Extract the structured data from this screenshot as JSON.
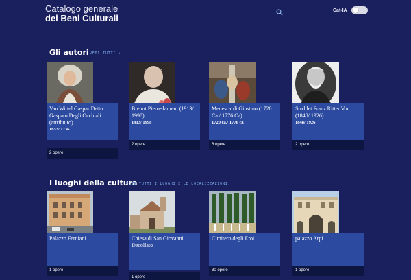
{
  "header": {
    "title_line1": "Catalogo generale",
    "title_line2": "dei Beni Culturali",
    "toggle_label": "Cat-IA"
  },
  "authors": {
    "title": "Gli autori",
    "see_all": "VEDI TUTTI ›",
    "items": [
      {
        "name": "Van Wittel Gaspar Detto Gasparo Degli Occhiali (attribuito)",
        "dates": "1653/ 1736",
        "works": "2 opere"
      },
      {
        "name": "Brenot Pierre-laurent (1913/ 1998)",
        "dates": "1913/ 1998",
        "works": "2 opere"
      },
      {
        "name": "Menescardi Giustino (1720 Ca./ 1776 Ca)",
        "dates": "1720 ca./ 1776 ca",
        "works": "6 opere"
      },
      {
        "name": "Soxhlet Franz Ritter Von (1848/ 1926)",
        "dates": "1848/ 1926",
        "works": "2 opere"
      }
    ]
  },
  "places": {
    "title": "I luoghi della cultura",
    "see_all": "VEDI TUTTI I LUOGHI E LE LOCALIZZAZIONI›",
    "items": [
      {
        "name": "Palazzo Ferniani",
        "works": "1 opere"
      },
      {
        "name": "Chiesa di San Giovanni Decollato",
        "works": "1 opere"
      },
      {
        "name": "Cimitero degli Eroi",
        "works": "30 opere"
      },
      {
        "name": "palazzo Arpi",
        "works": "1 opere"
      }
    ]
  }
}
